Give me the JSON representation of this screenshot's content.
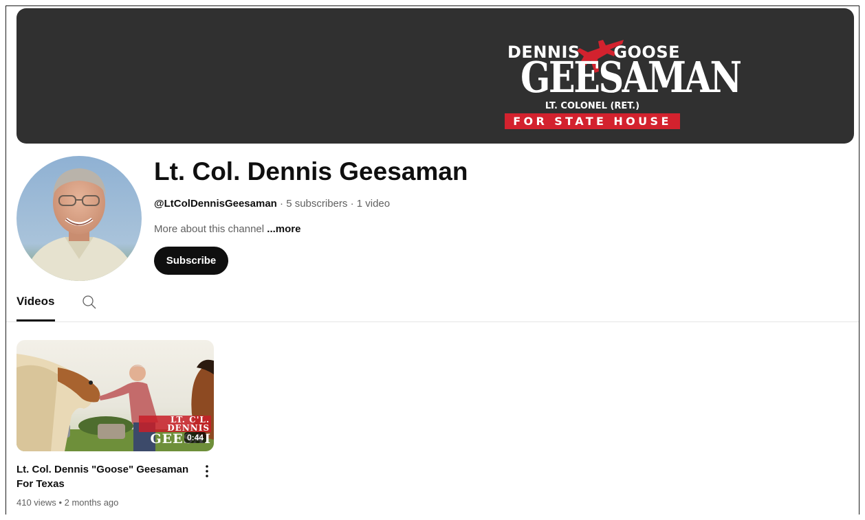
{
  "banner": {
    "logo": {
      "first_name": "DENNIS",
      "nickname": "GOOSE",
      "surname": "GEESAMAN",
      "rank": "LT. COLONEL (RET.)",
      "office": "FOR STATE HOUSE"
    },
    "colors": {
      "background": "#303030",
      "accent": "#d3222e"
    }
  },
  "channel": {
    "title": "Lt. Col. Dennis Geesaman",
    "handle": "@LtColDennisGeesaman",
    "subscribers": "5 subscribers",
    "video_count": "1 video",
    "about_text": "More about this channel",
    "about_more": "...more",
    "subscribe_label": "Subscribe"
  },
  "tabs": {
    "videos_label": "Videos",
    "search_icon": "search-icon"
  },
  "videos": [
    {
      "title": "Lt. Col. Dennis \"Goose\" Geesaman For Texas",
      "duration": "0:44",
      "views": "410 views",
      "age": "2 months ago",
      "thumb_overlay_line1": "LT. C'L. DENNIS",
      "thumb_overlay_line2": "GEESAI",
      "menu_icon": "more-vert-icon"
    }
  ]
}
